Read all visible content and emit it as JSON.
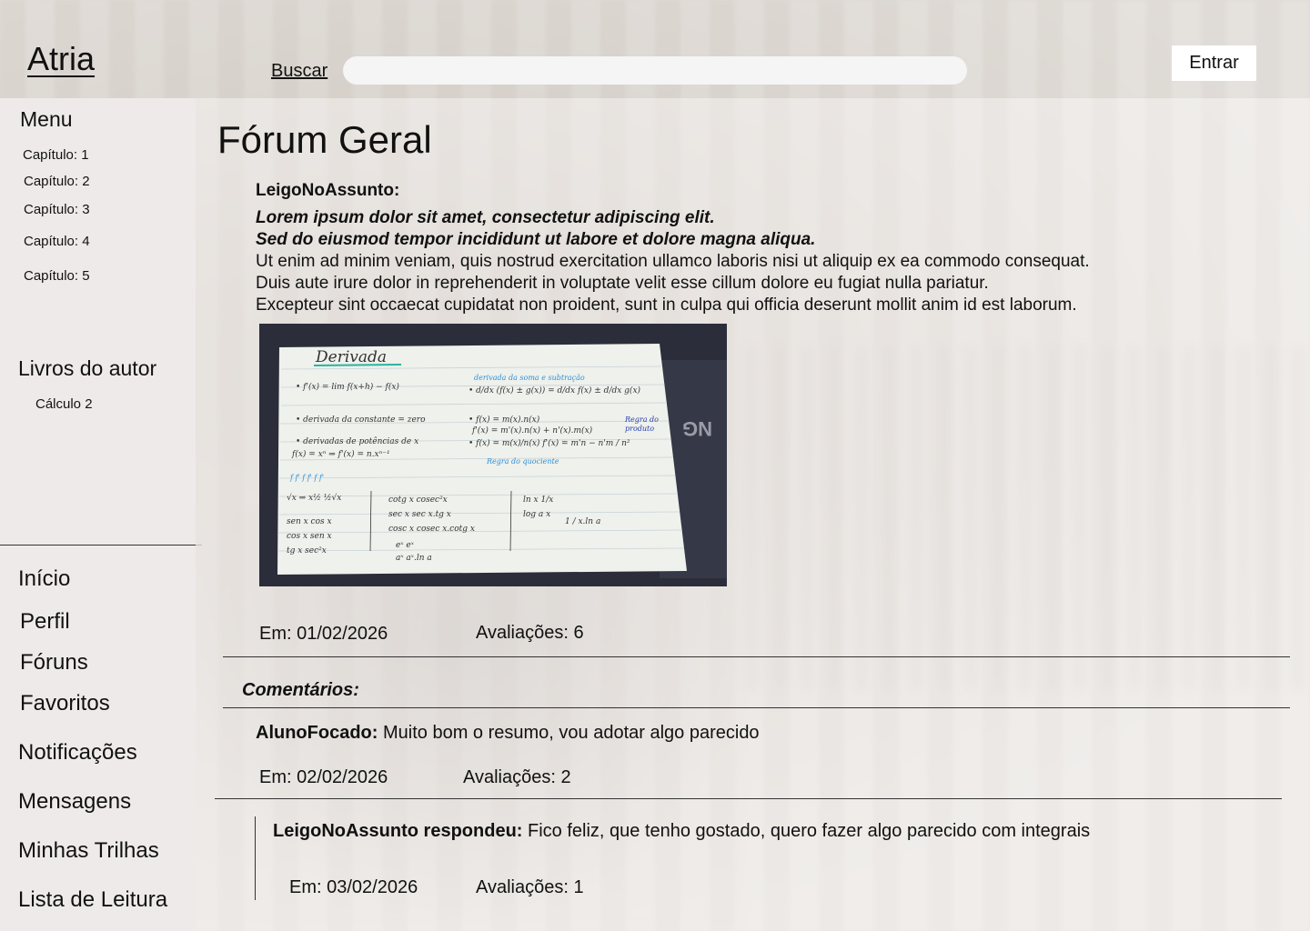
{
  "header": {
    "logo": "Atria",
    "search_label": "Buscar",
    "search_placeholder": "",
    "login_label": "Entrar"
  },
  "sidebar": {
    "menu_title": "Menu",
    "chapters": [
      "Capítulo: 1",
      "Capítulo: 2",
      "Capítulo: 3",
      "Capítulo: 4",
      "Capítulo: 5"
    ],
    "books_title": "Livros do autor",
    "books": [
      "Cálculo 2"
    ],
    "nav": [
      "Início",
      "Perfil",
      "Fóruns",
      "Favoritos",
      "Notificações",
      "Mensagens",
      "Minhas Trilhas",
      "Lista de Leitura"
    ]
  },
  "forum": {
    "title": "Fórum Geral",
    "post": {
      "author": "LeigoNoAssunto:",
      "line1": "Lorem ipsum dolor sit amet, consectetur adipiscing elit.",
      "line2": "Sed do eiusmod tempor incididunt ut labore et dolore magna aliqua.",
      "line3": "Ut enim ad minim veniam, quis nostrud exercitation ullamco laboris nisi ut aliquip ex ea commodo consequat.",
      "line4": "Duis aute irure dolor in reprehenderit in voluptate velit esse cillum dolore eu fugiat nulla pariatur.",
      "line5": "Excepteur sint occaecat cupidatat non proident, sunt in culpa qui officia deserunt mollit anim id est laborum.",
      "image_title": "Derivada",
      "date": "Em: 01/02/2026",
      "ratings": "Avaliações: 6"
    },
    "comments_title": "Comentários:",
    "comment": {
      "author": "AlunoFocado:",
      "text": " Muito bom o resumo, vou adotar algo parecido",
      "date": "Em: 02/02/2026",
      "ratings": "Avaliações: 2"
    },
    "reply": {
      "author": "LeigoNoAssunto respondeu:",
      "text": " Fico feliz, que tenho gostado, quero fazer algo parecido com integrais",
      "date": "Em: 03/02/2026",
      "ratings": "Avaliações: 1"
    }
  },
  "colors": {
    "sidebar_bg": "#efeaea",
    "button_bg": "#ffffff",
    "text": "#111111"
  }
}
